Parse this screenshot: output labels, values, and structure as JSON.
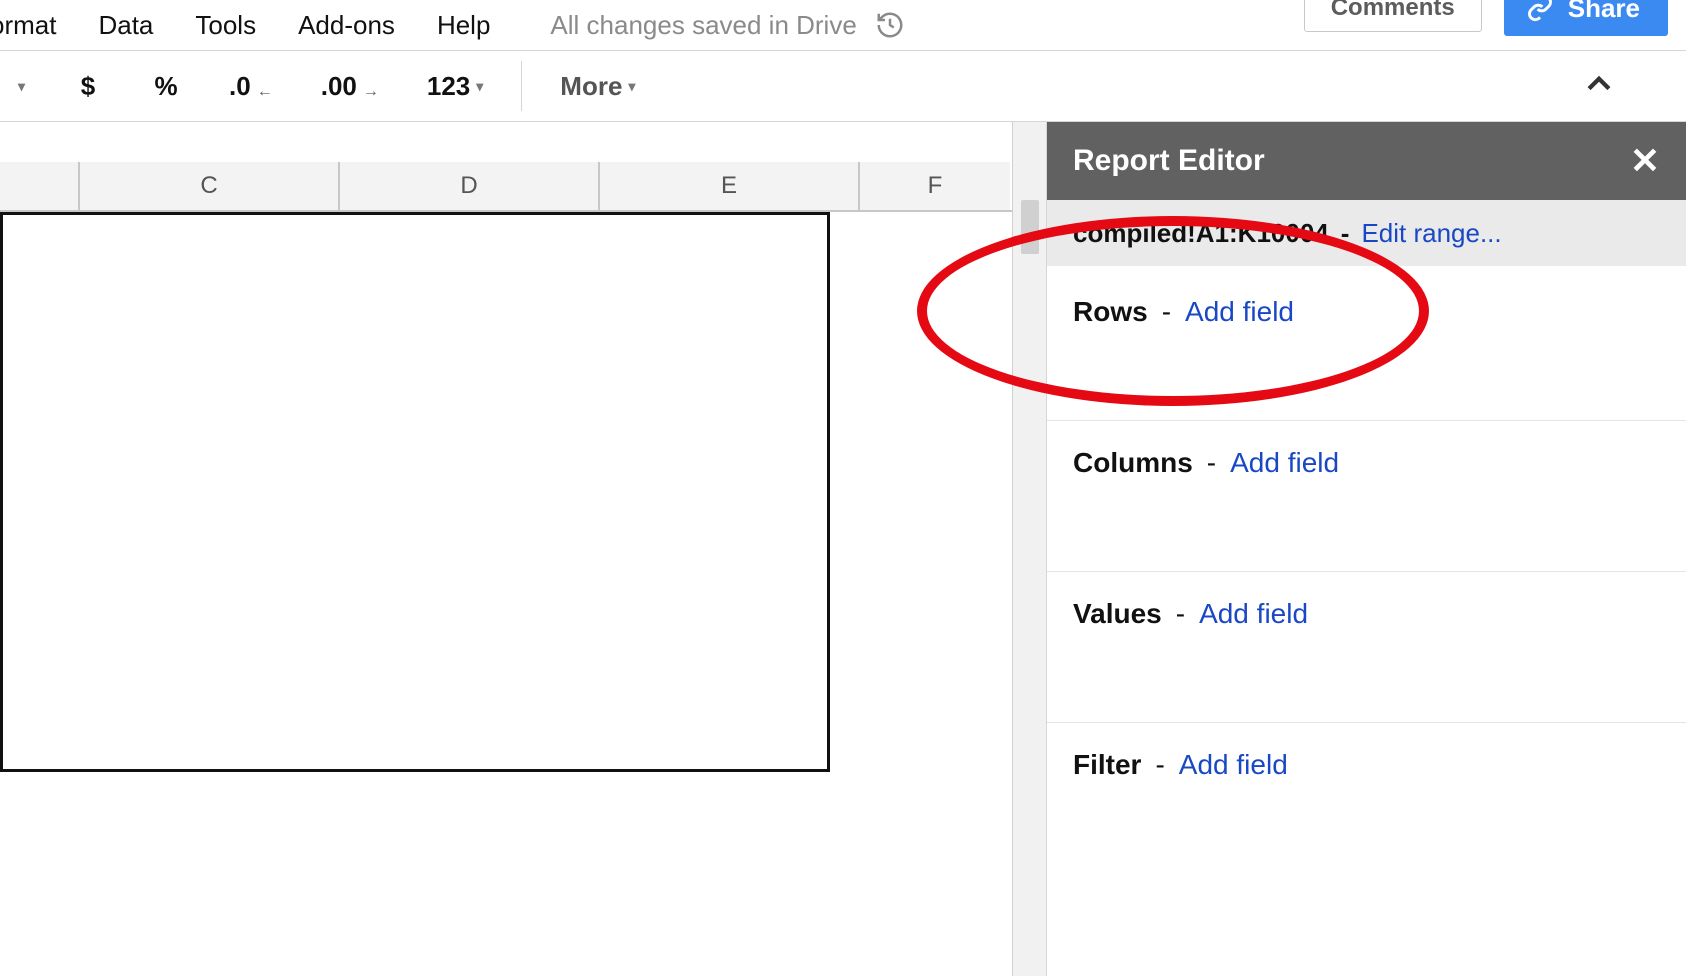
{
  "menu": {
    "format": "ormat",
    "data": "Data",
    "tools": "Tools",
    "addons": "Add-ons",
    "help": "Help"
  },
  "status": {
    "saved": "All changes saved in Drive"
  },
  "buttons": {
    "comments": "Comments",
    "share": "Share"
  },
  "toolbar": {
    "currency": "$",
    "percent": "%",
    "dec_decrease": ".0",
    "dec_increase": ".00",
    "number_format": "123",
    "more": "More"
  },
  "columns": {
    "c": "C",
    "d": "D",
    "e": "E",
    "f": "F"
  },
  "report_editor": {
    "title": "Report Editor",
    "range": "compiled!A1:K10004",
    "dash": "-",
    "edit_range": "Edit range...",
    "rows": "Rows",
    "columns": "Columns",
    "values": "Values",
    "filter": "Filter",
    "add_field": "Add field"
  }
}
